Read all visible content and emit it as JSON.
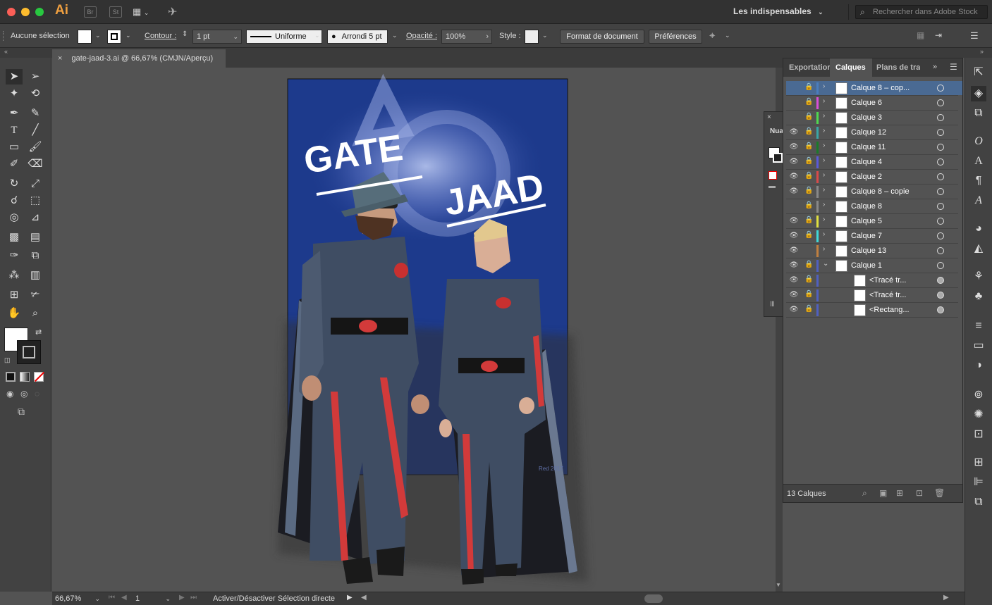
{
  "window": {
    "app_logo": "Ai",
    "bridge_label": "Br",
    "stock_label": "St",
    "workspace": "Les indispensables",
    "stock_search_placeholder": "Rechercher dans Adobe Stock"
  },
  "controlbar": {
    "selection": "Aucune sélection",
    "stroke_label": "Contour :",
    "stroke_weight": "1 pt",
    "profile": "Uniforme",
    "brush": "Arrondi 5 pt",
    "opacity_label": "Opacité :",
    "opacity": "100%",
    "style_label": "Style :",
    "doc_setup": "Format de document",
    "prefs": "Préférences"
  },
  "tab": {
    "title": "gate-jaad-3.ai @ 66,67% (CMJN/Aperçu)"
  },
  "artwork": {
    "title_left": "GATE",
    "title_right": "JAAD",
    "signature": "Red 2017",
    "bg_color": "#1d3a8c"
  },
  "swatches_peek": {
    "label": "Nua"
  },
  "layers_panel": {
    "tabs": [
      "Exportatior",
      "Calques",
      "Plans de tra"
    ],
    "rows": [
      {
        "name": "Calque 8 – cop...",
        "eye": false,
        "lock": true,
        "color": "#4a7dbd",
        "selected": true,
        "sub": false
      },
      {
        "name": "Calque 6",
        "eye": false,
        "lock": true,
        "color": "#d94fd9",
        "selected": false,
        "sub": false
      },
      {
        "name": "Calque 3",
        "eye": false,
        "lock": true,
        "color": "#4fd94f",
        "selected": false,
        "sub": false
      },
      {
        "name": "Calque 12",
        "eye": true,
        "lock": true,
        "color": "#3aa6a6",
        "selected": false,
        "sub": false
      },
      {
        "name": "Calque 11",
        "eye": true,
        "lock": true,
        "color": "#1a7a2a",
        "selected": false,
        "sub": false
      },
      {
        "name": "Calque 4",
        "eye": true,
        "lock": true,
        "color": "#5a5ad9",
        "selected": false,
        "sub": false
      },
      {
        "name": "Calque 2",
        "eye": true,
        "lock": true,
        "color": "#d94a4a",
        "selected": false,
        "sub": false
      },
      {
        "name": "Calque 8 – copie",
        "eye": true,
        "lock": true,
        "color": "#888888",
        "selected": false,
        "sub": false
      },
      {
        "name": "Calque 8",
        "eye": false,
        "lock": true,
        "color": "#888888",
        "selected": false,
        "sub": false
      },
      {
        "name": "Calque 5",
        "eye": true,
        "lock": true,
        "color": "#e0e040",
        "selected": false,
        "sub": false
      },
      {
        "name": "Calque 7",
        "eye": true,
        "lock": true,
        "color": "#40d9d9",
        "selected": false,
        "sub": false
      },
      {
        "name": "Calque 13",
        "eye": true,
        "lock": false,
        "color": "#c08040",
        "selected": false,
        "sub": false
      },
      {
        "name": "Calque 1",
        "eye": true,
        "lock": true,
        "color": "#5060c0",
        "selected": false,
        "sub": false
      },
      {
        "name": "<Tracé tr...",
        "eye": true,
        "lock": true,
        "color": "#5060c0",
        "selected": false,
        "sub": true
      },
      {
        "name": "<Tracé tr...",
        "eye": true,
        "lock": true,
        "color": "#5060c0",
        "selected": false,
        "sub": true
      },
      {
        "name": "<Rectang...",
        "eye": true,
        "lock": true,
        "color": "#5060c0",
        "selected": false,
        "sub": true
      }
    ],
    "count": "13 Calques"
  },
  "status": {
    "zoom": "66,67%",
    "artboard": "1",
    "message": "Activer/Désactiver Sélection directe"
  }
}
